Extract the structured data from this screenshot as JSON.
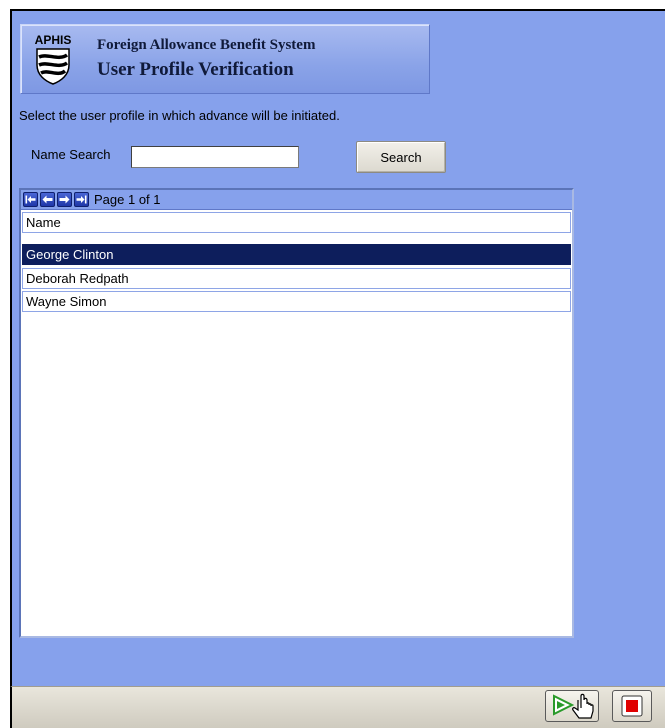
{
  "header": {
    "logo_text": "APHIS",
    "system_name": "Foreign Allowance Benefit System",
    "page_title": "User Profile Verification"
  },
  "instructions": "Select the user profile in which advance will be initiated.",
  "search": {
    "label": "Name Search",
    "value": "",
    "button_label": "Search"
  },
  "grid": {
    "page_info": "Page 1 of 1",
    "column_header": "Name",
    "rows": [
      {
        "name": "George Clinton",
        "selected": true
      },
      {
        "name": "Deborah Redpath",
        "selected": false
      },
      {
        "name": "Wayne Simon",
        "selected": false
      }
    ]
  },
  "colors": {
    "background": "#86a1ec",
    "selected_row": "#0d1e5c",
    "stop_red": "#e00000",
    "play_green": "#2a9a2a"
  },
  "icons": {
    "pager": [
      "first-page-icon",
      "previous-page-icon",
      "next-page-icon",
      "last-page-icon"
    ],
    "controls": [
      "play-icon",
      "hand-cursor-icon",
      "stop-icon"
    ]
  }
}
